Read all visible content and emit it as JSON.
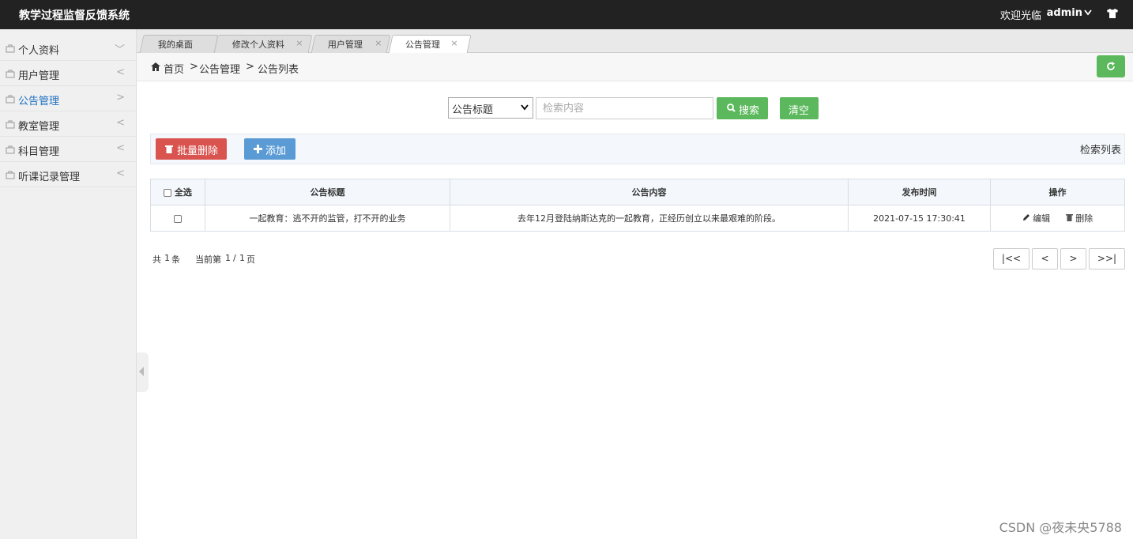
{
  "header": {
    "app_title": "教学过程监督反馈系统",
    "welcome": "欢迎光临",
    "username": "admin"
  },
  "sidebar": {
    "items": [
      {
        "label": "个人资料",
        "arrow": "﹀"
      },
      {
        "label": "用户管理",
        "arrow": "<"
      },
      {
        "label": "公告管理",
        "arrow": ">"
      },
      {
        "label": "教室管理",
        "arrow": "<"
      },
      {
        "label": "科目管理",
        "arrow": "<"
      },
      {
        "label": "听课记录管理",
        "arrow": "<"
      }
    ]
  },
  "tabs": [
    {
      "label": "我的桌面",
      "close": ""
    },
    {
      "label": "修改个人资料",
      "close": "×"
    },
    {
      "label": "用户管理",
      "close": "×"
    },
    {
      "label": "公告管理",
      "close": "×"
    }
  ],
  "breadcrumb": {
    "home": "首页",
    "sep": ">",
    "level1": "公告管理",
    "level2": "公告列表"
  },
  "search": {
    "field_selected": "公告标题",
    "placeholder": "检索内容",
    "search_label": "搜索",
    "clear_label": "清空"
  },
  "toolbar": {
    "batch_delete_label": "批量删除",
    "add_label": "添加",
    "list_label": "检索列表"
  },
  "table": {
    "select_all": "全选",
    "headers": [
      "公告标题",
      "公告内容",
      "发布时间",
      "操作"
    ],
    "rows": [
      {
        "title": "一起教育：逃不开的监管，打不开的业务",
        "content": "去年12月登陆纳斯达克的一起教育，正经历创立以来最艰难的阶段。",
        "time": "2021-07-15 17:30:41",
        "edit": "编辑",
        "delete": "删除"
      }
    ]
  },
  "pagination": {
    "total_prefix": "共",
    "total": "1",
    "total_suffix": "条",
    "current_prefix": "当前第",
    "current": "1",
    "sep": "/",
    "pages": "1",
    "pages_suffix": "页",
    "first": "|<<",
    "prev": "<",
    "next": ">",
    "last": ">>|"
  },
  "watermark": "CSDN @夜未央5788",
  "colors": {
    "green": "#5cb85c",
    "red": "#d9534f",
    "blue": "#5b9bd5",
    "header": "#222222"
  }
}
